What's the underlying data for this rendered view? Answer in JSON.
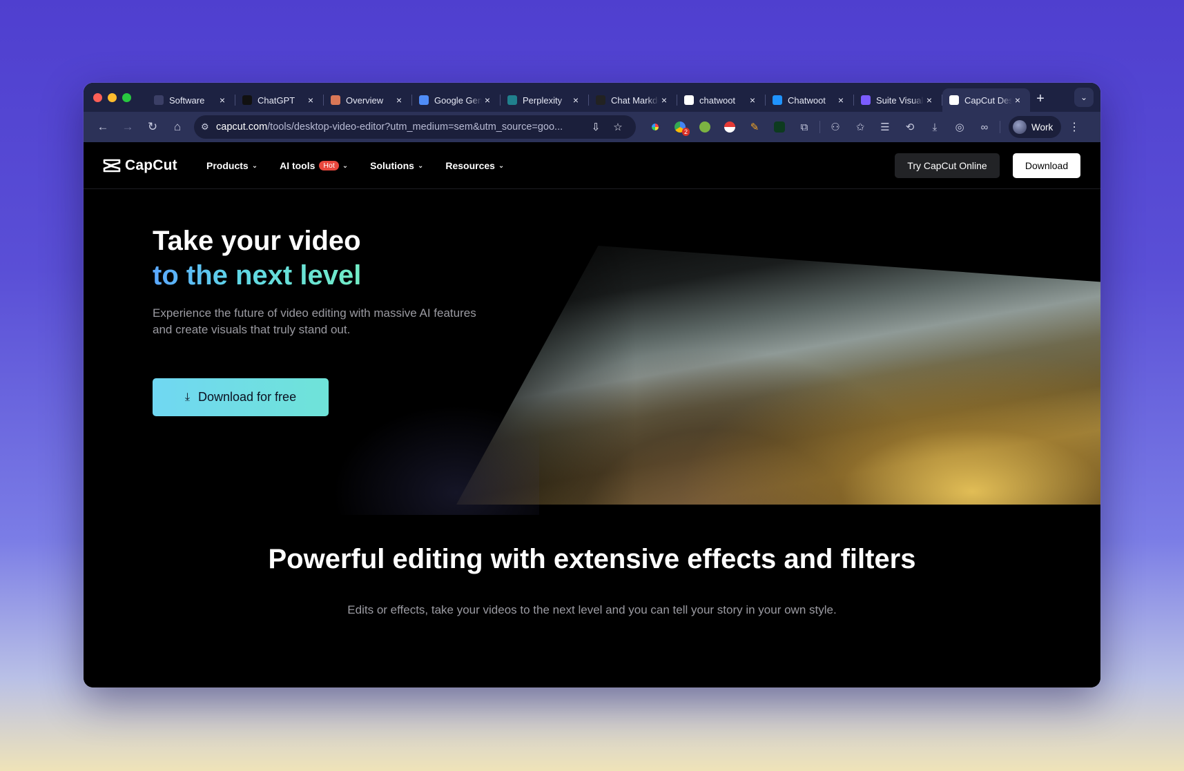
{
  "browser": {
    "tabs": [
      {
        "title": "Software",
        "favicon": "g-icon",
        "color": "#3b3f66"
      },
      {
        "title": "ChatGPT",
        "favicon": "openai-icon",
        "color": "#111111"
      },
      {
        "title": "Overview",
        "favicon": "claude-icon",
        "color": "#d97757"
      },
      {
        "title": "Google Gemini",
        "favicon": "gemini-icon",
        "color": "#4f8cf7"
      },
      {
        "title": "Perplexity",
        "favicon": "perplexity-icon",
        "color": "#20808d"
      },
      {
        "title": "Chat Markdown",
        "favicon": "markdown-icon",
        "color": "#222222"
      },
      {
        "title": "chatwoot",
        "favicon": "google-icon",
        "color": "#ffffff"
      },
      {
        "title": "Chatwoot",
        "favicon": "chatwoot-icon",
        "color": "#1f93ff"
      },
      {
        "title": "Suite Visual",
        "favicon": "suite-icon",
        "color": "#7b5cff"
      },
      {
        "title": "CapCut Desktop",
        "favicon": "capcut-icon",
        "color": "#ffffff"
      }
    ],
    "tab_close": "×",
    "new_tab": "+",
    "tab_menu": "⌄",
    "url_host": "capcut.com",
    "url_path": "/tools/desktop-video-editor?utm_medium=sem&utm_source=goo...",
    "profile_label": "Work",
    "extension_badge": "2"
  },
  "site": {
    "brand": "CapCut",
    "nav": {
      "products": "Products",
      "ai_tools": "AI tools",
      "hot_badge": "Hot",
      "solutions": "Solutions",
      "resources": "Resources"
    },
    "try_online": "Try CapCut Online",
    "download": "Download"
  },
  "hero": {
    "title_line1": "Take your video",
    "title_line2": "to the next level",
    "subtitle": "Experience the future of video editing with massive AI features and create visuals that truly stand out.",
    "cta": "Download for free"
  },
  "section": {
    "title": "Powerful editing with extensive effects and filters",
    "subtitle": "Edits or effects, take your videos to the next level and you can tell your story in your own style."
  },
  "colors": {
    "accent_gradient_start": "#5aa7ff",
    "accent_gradient_end": "#72ecc5",
    "hot_badge": "#e8473d",
    "cta_bg": "#70d7f2"
  }
}
